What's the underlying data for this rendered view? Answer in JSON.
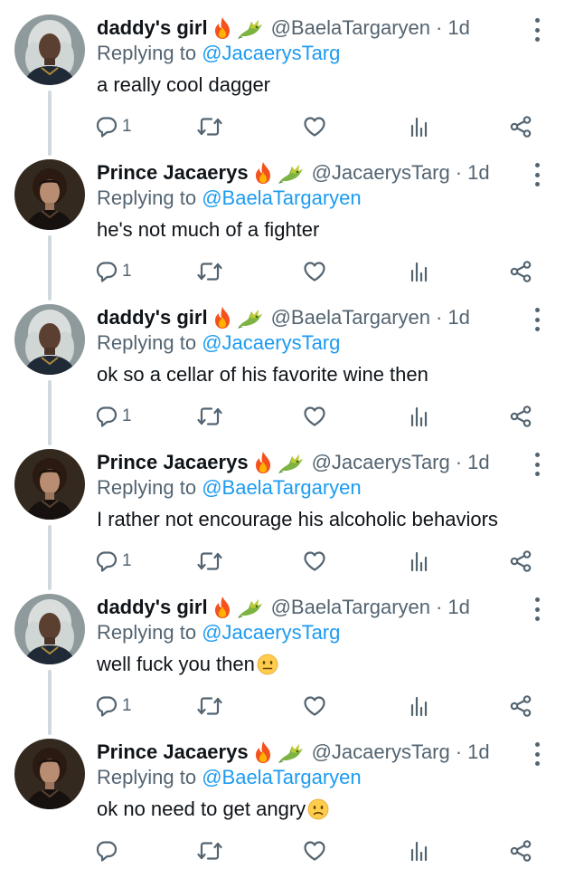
{
  "tweets": [
    {
      "name": "daddy's girl",
      "handle": "@BaelaTargaryen",
      "time": "1d",
      "replying_label": "Replying to",
      "replying_to": "@JacaerysTarg",
      "text": "a really cool dagger",
      "reply_count": "1",
      "avatar": "baela",
      "emoji_after_text": ""
    },
    {
      "name": "Prince Jacaerys",
      "handle": "@JacaerysTarg",
      "time": "1d",
      "replying_label": "Replying to",
      "replying_to": "@BaelaTargaryen",
      "text": "he's not much of a fighter",
      "reply_count": "1",
      "avatar": "jacaerys",
      "emoji_after_text": ""
    },
    {
      "name": "daddy's girl",
      "handle": "@BaelaTargaryen",
      "time": "1d",
      "replying_label": "Replying to",
      "replying_to": "@JacaerysTarg",
      "text": "ok so a cellar of his favorite wine then",
      "reply_count": "1",
      "avatar": "baela",
      "emoji_after_text": ""
    },
    {
      "name": "Prince Jacaerys",
      "handle": "@JacaerysTarg",
      "time": "1d",
      "replying_label": "Replying to",
      "replying_to": "@BaelaTargaryen",
      "text": "I rather not encourage his alcoholic behaviors",
      "reply_count": "1",
      "avatar": "jacaerys",
      "emoji_after_text": ""
    },
    {
      "name": "daddy's girl",
      "handle": "@BaelaTargaryen",
      "time": "1d",
      "replying_label": "Replying to",
      "replying_to": "@JacaerysTarg",
      "text": "well fuck you then",
      "reply_count": "1",
      "avatar": "baela",
      "emoji_after_text": "neutral-face"
    },
    {
      "name": "Prince Jacaerys",
      "handle": "@JacaerysTarg",
      "time": "1d",
      "replying_label": "Replying to",
      "replying_to": "@BaelaTargaryen",
      "text": "ok no need to get angry",
      "reply_count": "",
      "avatar": "jacaerys",
      "emoji_after_text": "slightly-frowning-face"
    }
  ],
  "name_emojis": [
    "fire-emoji",
    "dragon-emoji"
  ],
  "action_icons": [
    "reply-icon",
    "retweet-icon",
    "like-icon",
    "analytics-icon",
    "share-icon"
  ],
  "colors": {
    "link": "#1d9bf0",
    "secondary_text": "#536471",
    "thread_line": "#cfd9de",
    "primary_text": "#0f1419"
  }
}
